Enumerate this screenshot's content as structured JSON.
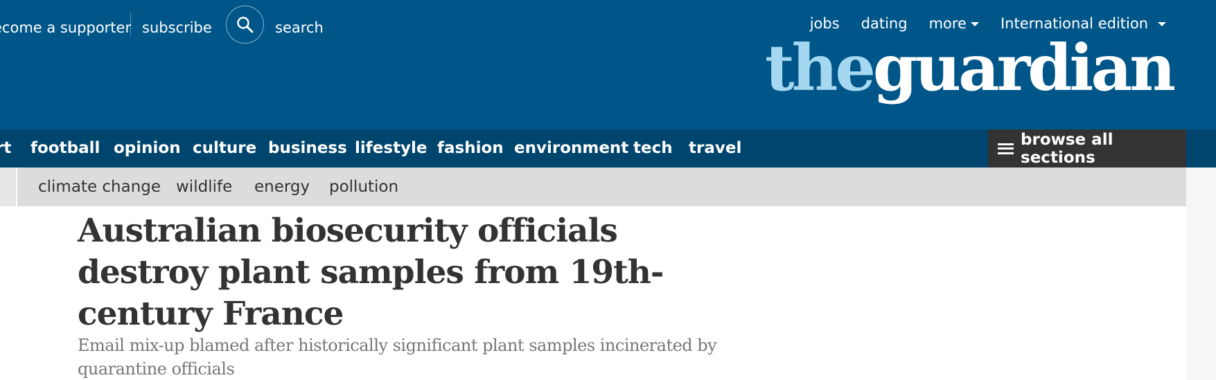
{
  "header": {
    "become_supporter": "ecome a supporter",
    "subscribe": "subscribe",
    "search_icon": "search-icon",
    "search_label": "search",
    "right_links": [
      "jobs",
      "dating",
      "more",
      "International edition"
    ],
    "logo_the": "the",
    "logo_guardian": "guardian"
  },
  "nav": {
    "pillars": [
      "rt",
      "football",
      "opinion",
      "culture",
      "business",
      "lifestyle",
      "fashion",
      "environment",
      "tech",
      "travel"
    ],
    "browse_label": "browse all sections"
  },
  "subnav": {
    "items": [
      "climate change",
      "wildlife",
      "energy",
      "pollution"
    ]
  },
  "article": {
    "headline": "Australian biosecurity officials destroy plant samples from 19th-century France",
    "standfirst": "Email mix-up blamed after historically significant plant samples incinerated by quarantine officials"
  },
  "colors": {
    "masthead": "#005689",
    "pillar_bar": "#00456e",
    "browse_bg": "#333333",
    "logo_the": "#a5d7f0",
    "subnav_bg": "#dcdcdc"
  }
}
